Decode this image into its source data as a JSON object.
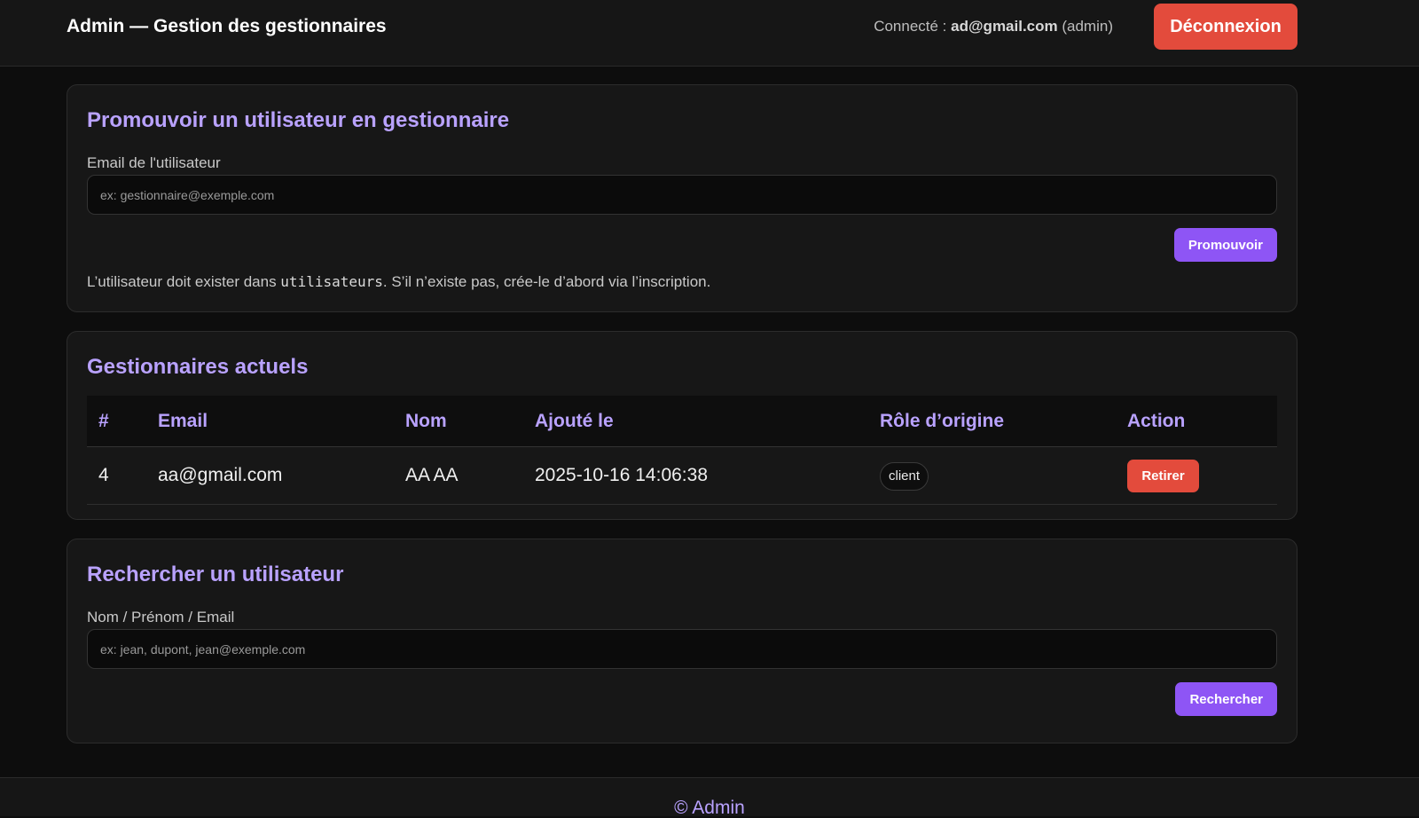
{
  "header": {
    "title": "Admin — Gestion des gestionnaires",
    "session_prefix": "Connecté : ",
    "user_email": "ad@gmail.com",
    "user_role": " (admin)",
    "logout_label": "Déconnexion"
  },
  "promote": {
    "title": "Promouvoir un utilisateur en gestionnaire",
    "email_label": "Email de l'utilisateur",
    "email_value": "",
    "email_placeholder": "ex: gestionnaire@exemple.com",
    "submit_label": "Promouvoir",
    "hint_before": "L’utilisateur doit exister dans ",
    "hint_code": "utilisateurs",
    "hint_after": ". S’il n’existe pas, crée-le d’abord via l’inscription."
  },
  "managers": {
    "title": "Gestionnaires actuels",
    "columns": [
      "#",
      "Email",
      "Nom",
      "Ajouté le",
      "Rôle d’origine",
      "Action"
    ],
    "rows": [
      {
        "id": "4",
        "email": "aa@gmail.com",
        "name": "AA AA",
        "added_on": "2025-10-16 14:06:38",
        "origin_role": "client",
        "action_label": "Retirer"
      }
    ]
  },
  "search": {
    "title": "Rechercher un utilisateur",
    "query_label": "Nom / Prénom / Email",
    "query_value": "",
    "query_placeholder": "ex: jean, dupont, jean@exemple.com",
    "submit_label": "Rechercher"
  },
  "footer": {
    "text": "© Admin"
  },
  "colors": {
    "accent": "#b9a2ff",
    "primary_button": "#8e55f5",
    "danger_button": "#e34b3c",
    "background": "#0d0d0d",
    "card": "#171717"
  }
}
